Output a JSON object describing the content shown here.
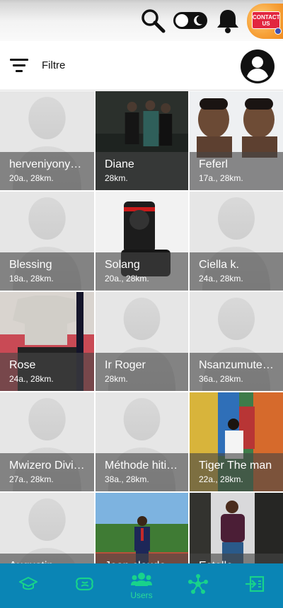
{
  "header": {
    "contact": "CONTACT US"
  },
  "filter": {
    "label": "Filtre"
  },
  "users": [
    {
      "name": "herveniyonyumva",
      "meta": "20a., 28km.",
      "photo": "placeholder"
    },
    {
      "name": "Diane",
      "meta": "28km.",
      "photo": "group"
    },
    {
      "name": "Feferl",
      "meta": "17a., 28km.",
      "photo": "portrait"
    },
    {
      "name": "Blessing",
      "meta": "18a., 28km.",
      "photo": "placeholder"
    },
    {
      "name": "Solang",
      "meta": "20a., 28km.",
      "photo": "camera"
    },
    {
      "name": "Ciella k.",
      "meta": "24a., 28km.",
      "photo": "placeholder"
    },
    {
      "name": "Rose",
      "meta": "24a., 28km.",
      "photo": "clothes"
    },
    {
      "name": "Ir Roger",
      "meta": "28km.",
      "photo": "placeholder"
    },
    {
      "name": "Nsanzumuteteri",
      "meta": "36a., 28km.",
      "photo": "placeholder"
    },
    {
      "name": "Mwizero Divine",
      "meta": "27a., 28km.",
      "photo": "placeholder"
    },
    {
      "name": "Méthode hitimana",
      "meta": "38a., 28km.",
      "photo": "placeholder"
    },
    {
      "name": "Tiger The man",
      "meta": "22a., 28km.",
      "photo": "painting"
    },
    {
      "name": "Augustin",
      "meta": "",
      "photo": "placeholder"
    },
    {
      "name": "Jean claude",
      "meta": "",
      "photo": "suit"
    },
    {
      "name": "Estella",
      "meta": "",
      "photo": "woman"
    }
  ],
  "nav": [
    {
      "icon": "graduation-cap-icon",
      "label": ""
    },
    {
      "icon": "brain-icon",
      "label": ""
    },
    {
      "icon": "users-icon",
      "label": "Users"
    },
    {
      "icon": "network-icon",
      "label": ""
    },
    {
      "icon": "logout-icon",
      "label": ""
    }
  ]
}
